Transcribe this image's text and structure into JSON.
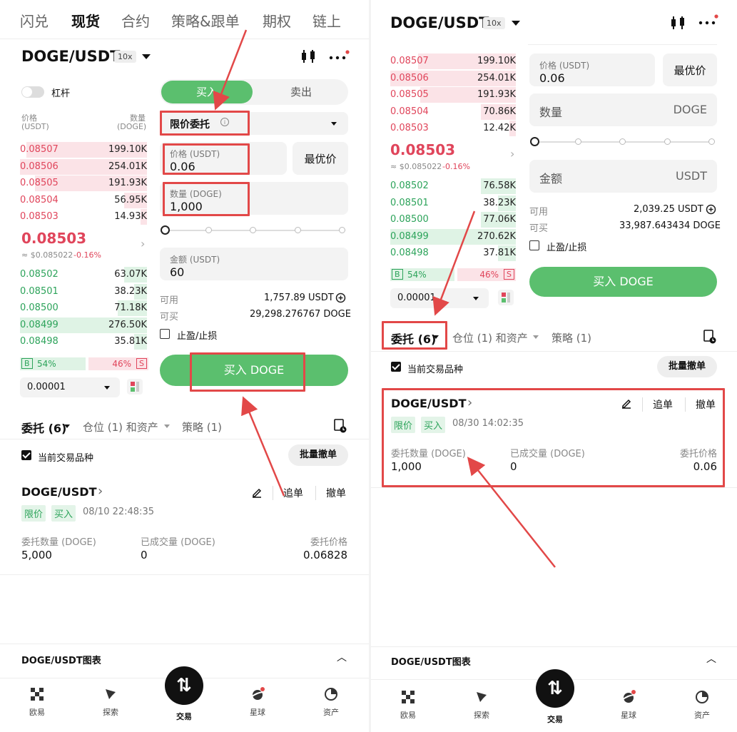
{
  "left": {
    "tabs": [
      "闪兑",
      "现货",
      "合约",
      "策略&跟单",
      "期权",
      "链上"
    ],
    "active_tab": "现货",
    "pair": "DOGE/USDT",
    "leverage": "10x",
    "margin_toggle_label": "杠杆",
    "ob_header": {
      "price": "价格",
      "price_unit": "(USDT)",
      "qty": "数量",
      "qty_unit": "(DOGE)"
    },
    "asks": [
      {
        "p": "0.08507",
        "q": "199.10K",
        "fill": 0.95
      },
      {
        "p": "0.08506",
        "q": "254.01K",
        "fill": 1.0
      },
      {
        "p": "0.08505",
        "q": "191.93K",
        "fill": 0.88
      },
      {
        "p": "0.08504",
        "q": "56.95K",
        "fill": 0.18
      },
      {
        "p": "0.08503",
        "q": "14.93K",
        "fill": 0.05
      }
    ],
    "last_price": "0.08503",
    "last_sub": "≈ $0.085022",
    "last_change": "-0.16%",
    "bids": [
      {
        "p": "0.08502",
        "q": "63.07K",
        "fill": 0.18
      },
      {
        "p": "0.08501",
        "q": "38.23K",
        "fill": 0.1
      },
      {
        "p": "0.08500",
        "q": "71.18K",
        "fill": 0.23
      },
      {
        "p": "0.08499",
        "q": "276.50K",
        "fill": 1.0
      },
      {
        "p": "0.08498",
        "q": "35.81K",
        "fill": 0.1
      }
    ],
    "buy_pct": "54%",
    "sell_pct": "46%",
    "b_label": "B",
    "s_label": "S",
    "precision": "0.00001",
    "buy_tab": "买入",
    "sell_tab": "卖出",
    "order_type": "限价委托",
    "price_label": "价格 (USDT)",
    "price_value": "0.06",
    "best_price": "最优价",
    "qty_label": "数量 (DOGE)",
    "qty_value": "1,000",
    "amount_label": "金额 (USDT)",
    "amount_value": "60",
    "avail_label": "可用",
    "avail_value": "1,757.89 USDT",
    "canbuy_label": "可买",
    "canbuy_value": "29,298.276767 DOGE",
    "tpsl_label": "止盈/止损",
    "buy_button": "买入 DOGE",
    "order_tabs": {
      "orders": "委托 (6)",
      "positions": "仓位 (1) 和资产",
      "strategy": "策略 (1)"
    },
    "current_pair_only": "当前交易品种",
    "batch_cancel": "批量撤单",
    "order": {
      "pair": "DOGE/USDT",
      "edit": "",
      "chase": "追单",
      "cancel": "撤单",
      "tag_type": "限价",
      "tag_side": "买入",
      "time": "08/10 22:48:35",
      "qty_label": "委托数量 (DOGE)",
      "qty": "5,000",
      "filled_label": "已成交量 (DOGE)",
      "filled": "0",
      "price_label": "委托价格",
      "price": "0.06828"
    },
    "chart_bar": "DOGE/USDT图表"
  },
  "right": {
    "pair": "DOGE/USDT",
    "leverage": "10x",
    "asks": [
      {
        "p": "0.08507",
        "q": "199.10K",
        "fill": 0.78
      },
      {
        "p": "0.08506",
        "q": "254.01K",
        "fill": 1.0
      },
      {
        "p": "0.08505",
        "q": "191.93K",
        "fill": 0.76
      },
      {
        "p": "0.08504",
        "q": "70.86K",
        "fill": 0.28
      },
      {
        "p": "0.08503",
        "q": "12.42K",
        "fill": 0.05
      }
    ],
    "last_price": "0.08503",
    "last_sub": "≈ $0.085022",
    "last_change": "-0.16%",
    "bids": [
      {
        "p": "0.08502",
        "q": "76.58K",
        "fill": 0.28
      },
      {
        "p": "0.08501",
        "q": "38.23K",
        "fill": 0.14
      },
      {
        "p": "0.08500",
        "q": "77.06K",
        "fill": 0.28
      },
      {
        "p": "0.08499",
        "q": "270.62K",
        "fill": 1.0
      },
      {
        "p": "0.08498",
        "q": "37.81K",
        "fill": 0.14
      }
    ],
    "buy_pct": "54%",
    "sell_pct": "46%",
    "b_label": "B",
    "s_label": "S",
    "precision": "0.00001",
    "price_label": "价格 (USDT)",
    "price_value": "0.06",
    "best_price": "最优价",
    "qty_placeholder": "数量",
    "qty_unit": "DOGE",
    "amount_placeholder": "金额",
    "amount_unit": "USDT",
    "avail_label": "可用",
    "avail_value": "2,039.25 USDT",
    "canbuy_label": "可买",
    "canbuy_value": "33,987.643434 DOGE",
    "tpsl_label": "止盈/止损",
    "buy_button": "买入 DOGE",
    "order_tabs": {
      "orders": "委托 (6)",
      "positions": "仓位 (1) 和资产",
      "strategy": "策略 (1)"
    },
    "current_pair_only": "当前交易品种",
    "batch_cancel": "批量撤单",
    "order": {
      "pair": "DOGE/USDT",
      "chase": "追单",
      "cancel": "撤单",
      "tag_type": "限价",
      "tag_side": "买入",
      "time": "08/30 14:02:35",
      "qty_label": "委托数量 (DOGE)",
      "qty": "1,000",
      "filled_label": "已成交量 (DOGE)",
      "filled": "0",
      "price_label": "委托价格",
      "price": "0.06"
    },
    "chart_bar": "DOGE/USDT图表"
  },
  "nav": [
    "欧易",
    "探索",
    "交易",
    "星球",
    "资产"
  ],
  "colors": {
    "green": "#5bbf6e",
    "red": "#e0455b",
    "annotation": "#e24848"
  }
}
